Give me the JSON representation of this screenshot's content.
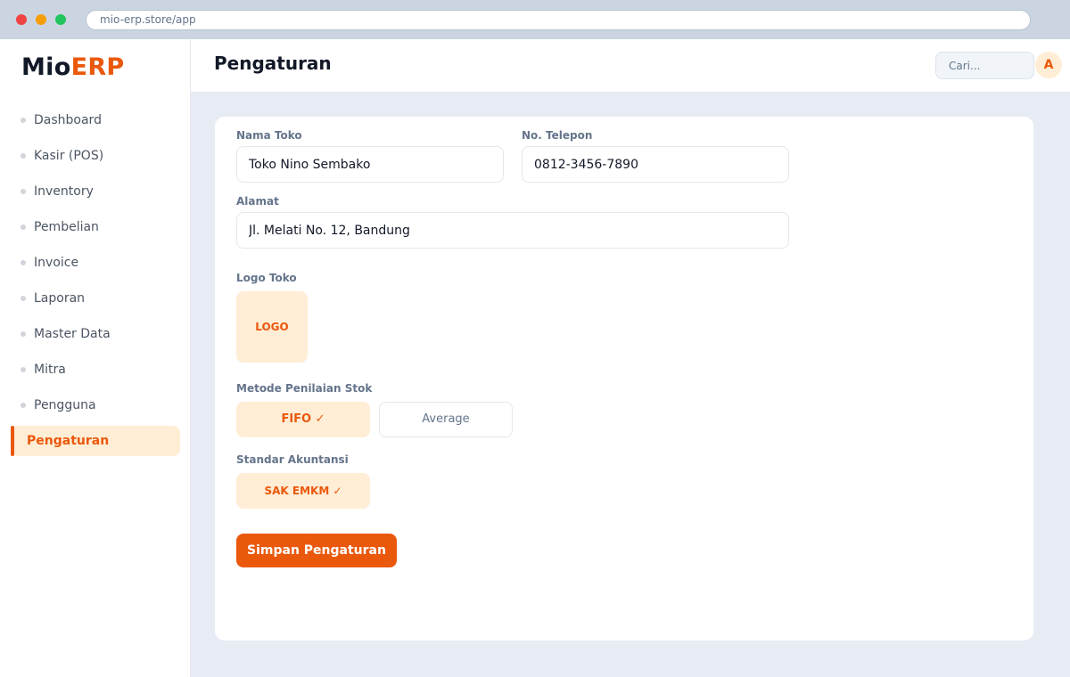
{
  "browser": {
    "url": "mio-erp.store/app"
  },
  "brand": {
    "part1": "Mio",
    "part2": "ERP",
    "accent_color": "#ea580c"
  },
  "sidebar": {
    "items": [
      {
        "label": "Dashboard"
      },
      {
        "label": "Kasir (POS)"
      },
      {
        "label": "Inventory"
      },
      {
        "label": "Pembelian"
      },
      {
        "label": "Invoice"
      },
      {
        "label": "Laporan"
      },
      {
        "label": "Master Data"
      },
      {
        "label": "Mitra"
      },
      {
        "label": "Pengguna"
      },
      {
        "label": "Pengaturan",
        "active": true
      }
    ]
  },
  "header": {
    "title": "Pengaturan",
    "search_placeholder": "Cari...",
    "avatar_initial": "A"
  },
  "form": {
    "store_name": {
      "label": "Nama Toko",
      "value": "Toko Nino Sembako"
    },
    "phone": {
      "label": "No. Telepon",
      "value": "0812-3456-7890"
    },
    "address": {
      "label": "Alamat",
      "value": "Jl. Melati No. 12, Bandung"
    },
    "logo": {
      "label": "Logo Toko",
      "placeholder_text": "LOGO"
    },
    "valuation": {
      "label": "Metode Penilaian Stok",
      "options": [
        {
          "label": "FIFO ✓",
          "selected": true
        },
        {
          "label": "Average",
          "selected": false
        }
      ]
    },
    "accounting": {
      "label": "Standar Akuntansi",
      "options": [
        {
          "label": "SAK EMKM ✓",
          "selected": true
        }
      ]
    },
    "save_label": "Simpan Pengaturan"
  }
}
